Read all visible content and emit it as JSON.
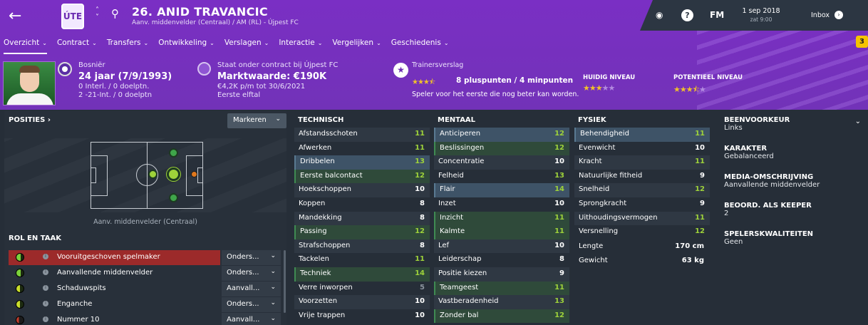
{
  "header": {
    "player_name": "26. ANID TRAVANCIC",
    "subtitle": "Aanv. middenvelder (Centraal) / AM (RL) - Újpest FC",
    "club_crest": "ÚTE",
    "date": "1 sep 2018",
    "time": "zat 9:00",
    "fm_label": "FM",
    "help_label": "?",
    "inbox_label": "Inbox",
    "badge_count": "3"
  },
  "tabs": [
    {
      "label": "Overzicht",
      "dropdown": true
    },
    {
      "label": "Contract",
      "dropdown": true
    },
    {
      "label": "Transfers",
      "dropdown": true
    },
    {
      "label": "Ontwikkeling",
      "dropdown": true
    },
    {
      "label": "Verslagen",
      "dropdown": true
    },
    {
      "label": "Interactie",
      "dropdown": true
    },
    {
      "label": "Vergelijken",
      "dropdown": true
    },
    {
      "label": "Geschiedenis",
      "dropdown": true
    }
  ],
  "info": {
    "nationality": "Bosniër",
    "age": "24 jaar (7/9/1993)",
    "intl": "0 Interl. / 0 doelptn.",
    "u21": "2 -21-Int. / 0 doelptn",
    "contract_status": "Staat onder contract bij Újpest FC",
    "value": "Marktwaarde: €190K",
    "wage": "€4,2K p/m tot 30/6/2021",
    "squad": "Eerste elftal",
    "trainer_label": "Trainersverslag",
    "trainer_points": "8 pluspunten / 4 minpunten",
    "trainer_desc": "Speler voor het eerste die nog beter kan worden.",
    "current_label": "HUIDIG NIVEAU",
    "potential_label": "POTENTIEEL NIVEAU",
    "trainer_stars": 3.5,
    "current_stars": 3,
    "potential_stars": 3.5
  },
  "positions": {
    "title": "POSITIES",
    "mark_button": "Markeren",
    "position_label": "Aanv. middenvelder (Centraal)"
  },
  "roles": {
    "title": "ROL EN TAAK",
    "items": [
      {
        "name": "Vooruitgeschoven spelmaker",
        "duty": "Onders...",
        "selected": true
      },
      {
        "name": "Aanvallende middenvelder",
        "duty": "Onders..."
      },
      {
        "name": "Schaduwspits",
        "duty": "Aanvall..."
      },
      {
        "name": "Enganche",
        "duty": "Onders..."
      },
      {
        "name": "Nummer 10",
        "duty": "Aanvall..."
      }
    ]
  },
  "technisch": {
    "title": "TECHNISCH",
    "rows": [
      {
        "name": "Afstandsschoten",
        "value": "11"
      },
      {
        "name": "Afwerken",
        "value": "11"
      },
      {
        "name": "Dribbelen",
        "value": "13"
      },
      {
        "name": "Eerste balcontact",
        "value": "12"
      },
      {
        "name": "Hoekschoppen",
        "value": "10"
      },
      {
        "name": "Koppen",
        "value": "8"
      },
      {
        "name": "Mandekking",
        "value": "8"
      },
      {
        "name": "Passing",
        "value": "12"
      },
      {
        "name": "Strafschoppen",
        "value": "8"
      },
      {
        "name": "Tackelen",
        "value": "11"
      },
      {
        "name": "Techniek",
        "value": "14"
      },
      {
        "name": "Verre inworpen",
        "value": "5"
      },
      {
        "name": "Voorzetten",
        "value": "10"
      },
      {
        "name": "Vrije trappen",
        "value": "10"
      }
    ]
  },
  "mentaal": {
    "title": "MENTAAL",
    "rows": [
      {
        "name": "Anticiperen",
        "value": "12"
      },
      {
        "name": "Beslissingen",
        "value": "12"
      },
      {
        "name": "Concentratie",
        "value": "10"
      },
      {
        "name": "Felheid",
        "value": "13"
      },
      {
        "name": "Flair",
        "value": "14"
      },
      {
        "name": "Inzet",
        "value": "10"
      },
      {
        "name": "Inzicht",
        "value": "11"
      },
      {
        "name": "Kalmte",
        "value": "11"
      },
      {
        "name": "Lef",
        "value": "10"
      },
      {
        "name": "Leiderschap",
        "value": "8"
      },
      {
        "name": "Positie kiezen",
        "value": "9"
      },
      {
        "name": "Teamgeest",
        "value": "11"
      },
      {
        "name": "Vastberadenheid",
        "value": "13"
      },
      {
        "name": "Zonder bal",
        "value": "12"
      }
    ]
  },
  "fysiek": {
    "title": "FYSIEK",
    "rows": [
      {
        "name": "Behendigheid",
        "value": "11"
      },
      {
        "name": "Evenwicht",
        "value": "10"
      },
      {
        "name": "Kracht",
        "value": "11"
      },
      {
        "name": "Natuurlijke fitheid",
        "value": "9"
      },
      {
        "name": "Snelheid",
        "value": "12"
      },
      {
        "name": "Sprongkracht",
        "value": "9"
      },
      {
        "name": "Uithoudingsvermogen",
        "value": "11"
      },
      {
        "name": "Versnelling",
        "value": "12"
      }
    ],
    "extra": [
      {
        "name": "Lengte",
        "value": "170 cm"
      },
      {
        "name": "Gewicht",
        "value": "63 kg"
      }
    ]
  },
  "side": {
    "foot_label": "BEENVOORKEUR",
    "foot": "Links",
    "char_label": "KARAKTER",
    "char": "Gebalanceerd",
    "media_label": "MEDIA-OMSCHRIJVING",
    "media": "Aanvallende middenvelder",
    "keeper_label": "BEOORD. ALS KEEPER",
    "keeper": "2",
    "qual_label": "SPELERSKWALITEITEN",
    "qual": "Geen"
  }
}
